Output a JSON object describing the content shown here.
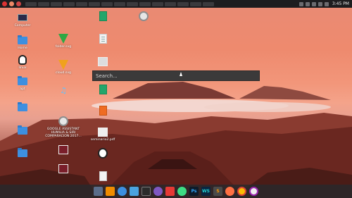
{
  "search": {
    "placeholder": "Search..."
  },
  "panel": {
    "time": "3:45 PM"
  },
  "desktop": {
    "icons": [
      {
        "name": "desktop-icon-computer",
        "label": "Computer"
      },
      {
        "name": "desktop-icon-home",
        "label": "Home"
      },
      {
        "name": "desktop-icon-linux",
        "label": "linux"
      },
      {
        "name": "desktop-icon-apt",
        "label": "apt"
      },
      {
        "name": "desktop-icon-folder-4",
        "label": ""
      },
      {
        "name": "desktop-icon-folder-5",
        "label": ""
      },
      {
        "name": "desktop-icon-folder-6",
        "label": ""
      },
      {
        "name": "desktop-icon-folder-7",
        "label": ""
      },
      {
        "name": "desktop-icon-green-file",
        "label": "folder.svg"
      },
      {
        "name": "desktop-icon-orange-file",
        "label": "cloud.svg"
      },
      {
        "name": "desktop-icon-music",
        "label": ""
      },
      {
        "name": "desktop-icon-google-assistant",
        "label": "GOOGLE ASSISTANT HUMILIA & SIRI COMPARACION 2017..."
      },
      {
        "name": "desktop-icon-thumb-1",
        "label": ""
      },
      {
        "name": "desktop-icon-thumb-2",
        "label": ""
      },
      {
        "name": "desktop-icon-sheet",
        "label": ""
      },
      {
        "name": "desktop-icon-doc",
        "label": ""
      },
      {
        "name": "desktop-icon-image",
        "label": ""
      },
      {
        "name": "desktop-icon-sheet-2",
        "label": ""
      },
      {
        "name": "desktop-icon-slides",
        "label": ""
      },
      {
        "name": "desktop-icon-pdf",
        "label": "seminario2.pdf"
      },
      {
        "name": "desktop-icon-sphere",
        "label": ""
      },
      {
        "name": "desktop-icon-video",
        "label": ""
      }
    ]
  },
  "dock": {
    "items": [
      {
        "name": "files",
        "label": ""
      },
      {
        "name": "vlc",
        "label": ""
      },
      {
        "name": "apps-grid",
        "label": ""
      },
      {
        "name": "folder",
        "label": ""
      },
      {
        "name": "terminal",
        "label": ""
      },
      {
        "name": "chat",
        "label": ""
      },
      {
        "name": "store",
        "label": ""
      },
      {
        "name": "android",
        "label": ""
      },
      {
        "name": "photoshop",
        "label": "Ps"
      },
      {
        "name": "webstorm",
        "label": "WS"
      },
      {
        "name": "sublime",
        "label": "S"
      },
      {
        "name": "reader",
        "label": ""
      },
      {
        "name": "chrome",
        "label": ""
      },
      {
        "name": "settings",
        "label": ""
      }
    ]
  }
}
